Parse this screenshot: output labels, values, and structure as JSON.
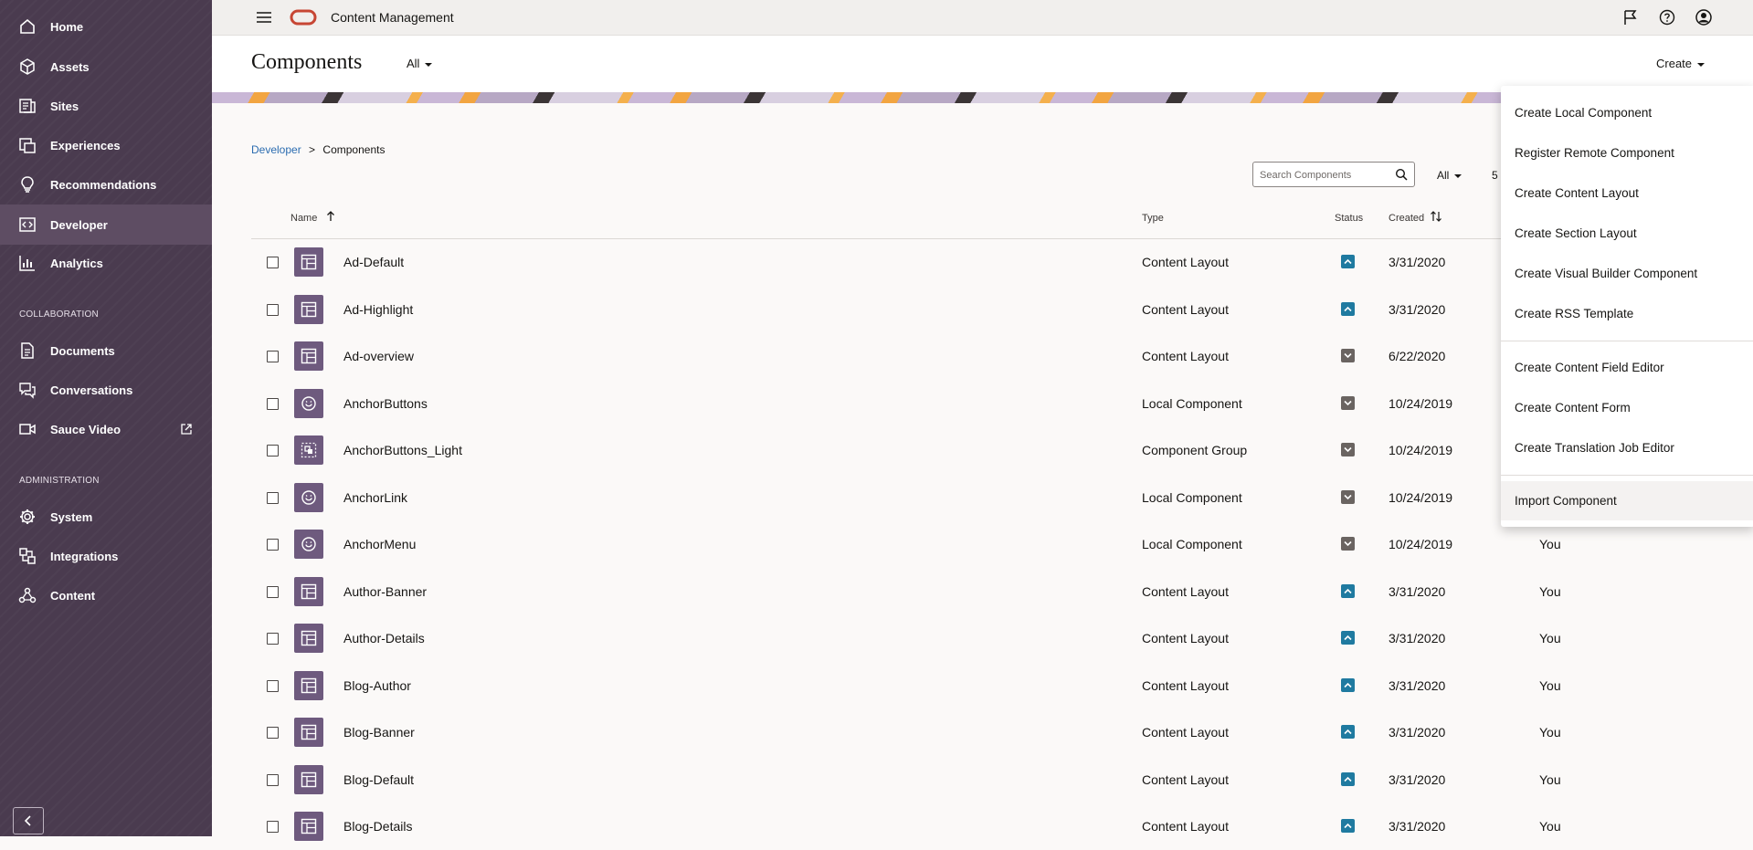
{
  "app": {
    "title": "Content Management"
  },
  "sidebar": {
    "items": [
      {
        "label": "Home",
        "icon": "home-icon"
      },
      {
        "label": "Assets",
        "icon": "cube-icon"
      },
      {
        "label": "Sites",
        "icon": "sites-icon"
      },
      {
        "label": "Experiences",
        "icon": "experiences-icon"
      },
      {
        "label": "Recommendations",
        "icon": "lightbulb-icon"
      },
      {
        "label": "Developer",
        "icon": "code-icon"
      },
      {
        "label": "Analytics",
        "icon": "chart-icon"
      }
    ],
    "collab_heading": "COLLABORATION",
    "collab_items": [
      {
        "label": "Documents",
        "icon": "documents-icon"
      },
      {
        "label": "Conversations",
        "icon": "conversations-icon"
      },
      {
        "label": "Sauce Video",
        "icon": "video-icon"
      }
    ],
    "admin_heading": "ADMINISTRATION",
    "admin_items": [
      {
        "label": "System",
        "icon": "gear-icon"
      },
      {
        "label": "Integrations",
        "icon": "integrations-icon"
      },
      {
        "label": "Content",
        "icon": "content-icon"
      }
    ]
  },
  "page": {
    "title": "Components",
    "filter": "All",
    "create": "Create",
    "breadcrumb_parent": "Developer",
    "breadcrumb_sep": ">",
    "breadcrumb_current": "Components",
    "search_placeholder": "Search Components",
    "type_filter": "All",
    "count_fragment": "5"
  },
  "table": {
    "headers": {
      "name": "Name",
      "type": "Type",
      "status": "Status",
      "created": "Created"
    },
    "rows": [
      {
        "name": "Ad-Default",
        "type": "Content Layout",
        "status": "published",
        "created": "3/31/2020",
        "by": "",
        "icon": "layout-icon"
      },
      {
        "name": "Ad-Highlight",
        "type": "Content Layout",
        "status": "published",
        "created": "3/31/2020",
        "by": "",
        "icon": "layout-icon"
      },
      {
        "name": "Ad-overview",
        "type": "Content Layout",
        "status": "draft",
        "created": "6/22/2020",
        "by": "",
        "icon": "layout-icon"
      },
      {
        "name": "AnchorButtons",
        "type": "Local Component",
        "status": "draft",
        "created": "10/24/2019",
        "by": "",
        "icon": "smiley-icon"
      },
      {
        "name": "AnchorButtons_Light",
        "type": "Component Group",
        "status": "draft",
        "created": "10/24/2019",
        "by": "",
        "icon": "group-icon"
      },
      {
        "name": "AnchorLink",
        "type": "Local Component",
        "status": "draft",
        "created": "10/24/2019",
        "by": "",
        "icon": "smiley-icon"
      },
      {
        "name": "AnchorMenu",
        "type": "Local Component",
        "status": "draft",
        "created": "10/24/2019",
        "by": "You",
        "icon": "smiley-icon"
      },
      {
        "name": "Author-Banner",
        "type": "Content Layout",
        "status": "published",
        "created": "3/31/2020",
        "by": "You",
        "icon": "layout-icon"
      },
      {
        "name": "Author-Details",
        "type": "Content Layout",
        "status": "published",
        "created": "3/31/2020",
        "by": "You",
        "icon": "layout-icon"
      },
      {
        "name": "Blog-Author",
        "type": "Content Layout",
        "status": "published",
        "created": "3/31/2020",
        "by": "You",
        "icon": "layout-icon"
      },
      {
        "name": "Blog-Banner",
        "type": "Content Layout",
        "status": "published",
        "created": "3/31/2020",
        "by": "You",
        "icon": "layout-icon"
      },
      {
        "name": "Blog-Default",
        "type": "Content Layout",
        "status": "published",
        "created": "3/31/2020",
        "by": "You",
        "icon": "layout-icon"
      },
      {
        "name": "Blog-Details",
        "type": "Content Layout",
        "status": "published",
        "created": "3/31/2020",
        "by": "You",
        "icon": "layout-icon"
      }
    ]
  },
  "create_menu": {
    "group1": [
      "Create Local Component",
      "Register Remote Component",
      "Create Content Layout",
      "Create Section Layout",
      "Create Visual Builder Component",
      "Create RSS Template"
    ],
    "group2": [
      "Create Content Field Editor",
      "Create Content Form",
      "Create Translation Job Editor"
    ],
    "group3": [
      "Import Component"
    ]
  },
  "colors": {
    "sidebar": "#4a3b4f",
    "sidebar_active": "#5e4d63",
    "brand_red": "#c74634",
    "link": "#2b6cb0",
    "status_published": "#1f7aa0",
    "status_draft": "#6a6461",
    "type_icon_bg": "#6e5a7e"
  }
}
